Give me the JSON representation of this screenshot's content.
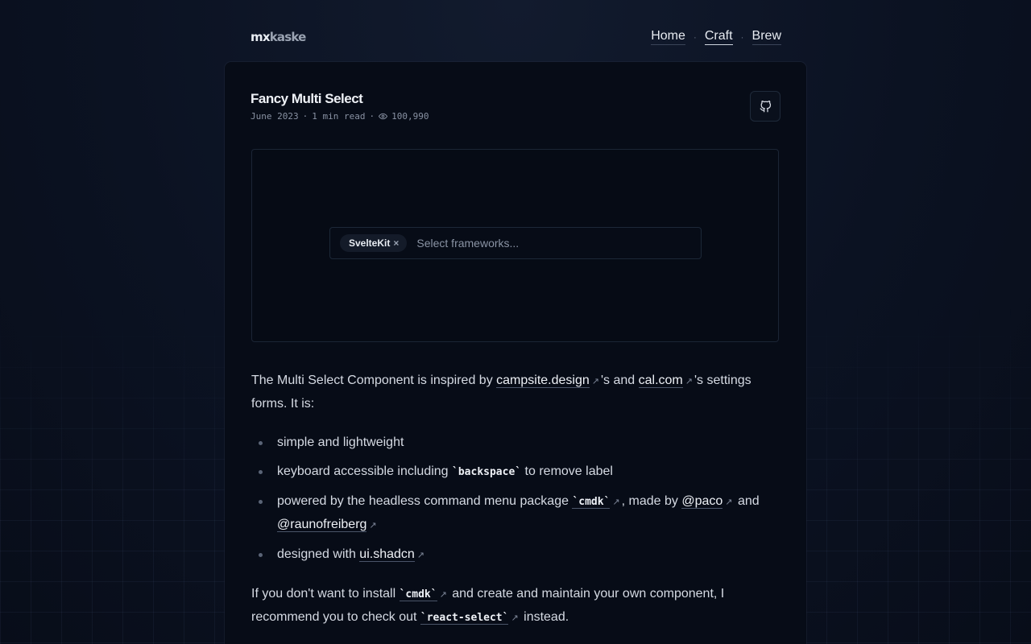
{
  "header": {
    "logo_primary": "mx",
    "logo_secondary": "kaske",
    "nav": [
      {
        "label": "Home",
        "active": false
      },
      {
        "label": "Craft",
        "active": true
      },
      {
        "label": "Brew",
        "active": false
      }
    ],
    "nav_separator": "·"
  },
  "post": {
    "title": "Fancy Multi Select",
    "date": "June 2023",
    "read_time": "1 min read",
    "views": "100,990",
    "meta_separator": "·"
  },
  "demo": {
    "chip_label": "SvelteKit",
    "chip_remove": "×",
    "input_placeholder": "Select frameworks..."
  },
  "content": {
    "intro_1": "The Multi Select Component is inspired by ",
    "link_campsite": "campsite.design",
    "intro_2": "'s and ",
    "link_cal": "cal.com",
    "intro_3": "'s settings forms. It is:",
    "list": {
      "item1": "simple and lightweight",
      "item2_a": "keyboard accessible including ",
      "item2_code": "`backspace`",
      "item2_b": " to remove label",
      "item3_a": "powered by the headless command menu package ",
      "item3_code": "`cmdk`",
      "item3_b": ", made by ",
      "item3_link1": "@paco",
      "item3_c": " and ",
      "item3_link2": "@raunofreiberg",
      "item4_a": "designed with ",
      "item4_link": "ui.shadcn"
    },
    "outro_1": "If you don't want to install ",
    "outro_code1": "`cmdk`",
    "outro_2": " and create and maintain your own component, I recommend you to check out ",
    "outro_code2": "`react-select`",
    "outro_3": " instead.",
    "external_glyph": "↗"
  },
  "icons": {
    "github": "github-icon",
    "eye": "eye-icon",
    "external": "external-link-icon",
    "close": "close-icon"
  }
}
